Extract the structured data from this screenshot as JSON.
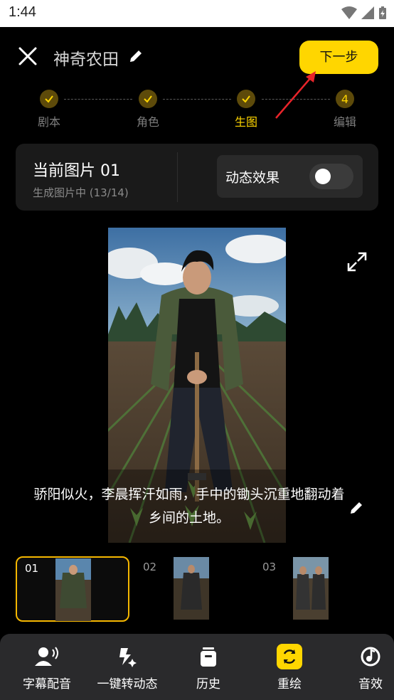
{
  "status": {
    "time": "1:44"
  },
  "header": {
    "title": "神奇农田",
    "next_label": "下一步"
  },
  "steps": [
    {
      "label": "剧本",
      "state": "done"
    },
    {
      "label": "角色",
      "state": "done"
    },
    {
      "label": "生图",
      "state": "done"
    },
    {
      "label": "编辑",
      "state": "pending",
      "number": "4"
    }
  ],
  "info": {
    "current_title": "当前图片 01",
    "status": "生成图片中 (13/14)",
    "motion_label": "动态效果",
    "motion_enabled": false
  },
  "caption": "骄阳似火，李晨挥汗如雨，手中的锄头沉重地翻动着乡间的土地。",
  "thumbnails": [
    {
      "number": "01",
      "selected": true
    },
    {
      "number": "02",
      "selected": false
    },
    {
      "number": "03",
      "selected": false
    }
  ],
  "toolbar": [
    {
      "label": "字幕配音",
      "icon": "voice-icon"
    },
    {
      "label": "一键转动态",
      "icon": "sparkle-icon"
    },
    {
      "label": "历史",
      "icon": "history-icon"
    },
    {
      "label": "重绘",
      "icon": "redraw-icon"
    },
    {
      "label": "音效",
      "icon": "music-icon"
    }
  ],
  "colors": {
    "accent": "#ffd600",
    "step_done": "#5d4a0a",
    "annotation_arrow": "#e8242a"
  }
}
